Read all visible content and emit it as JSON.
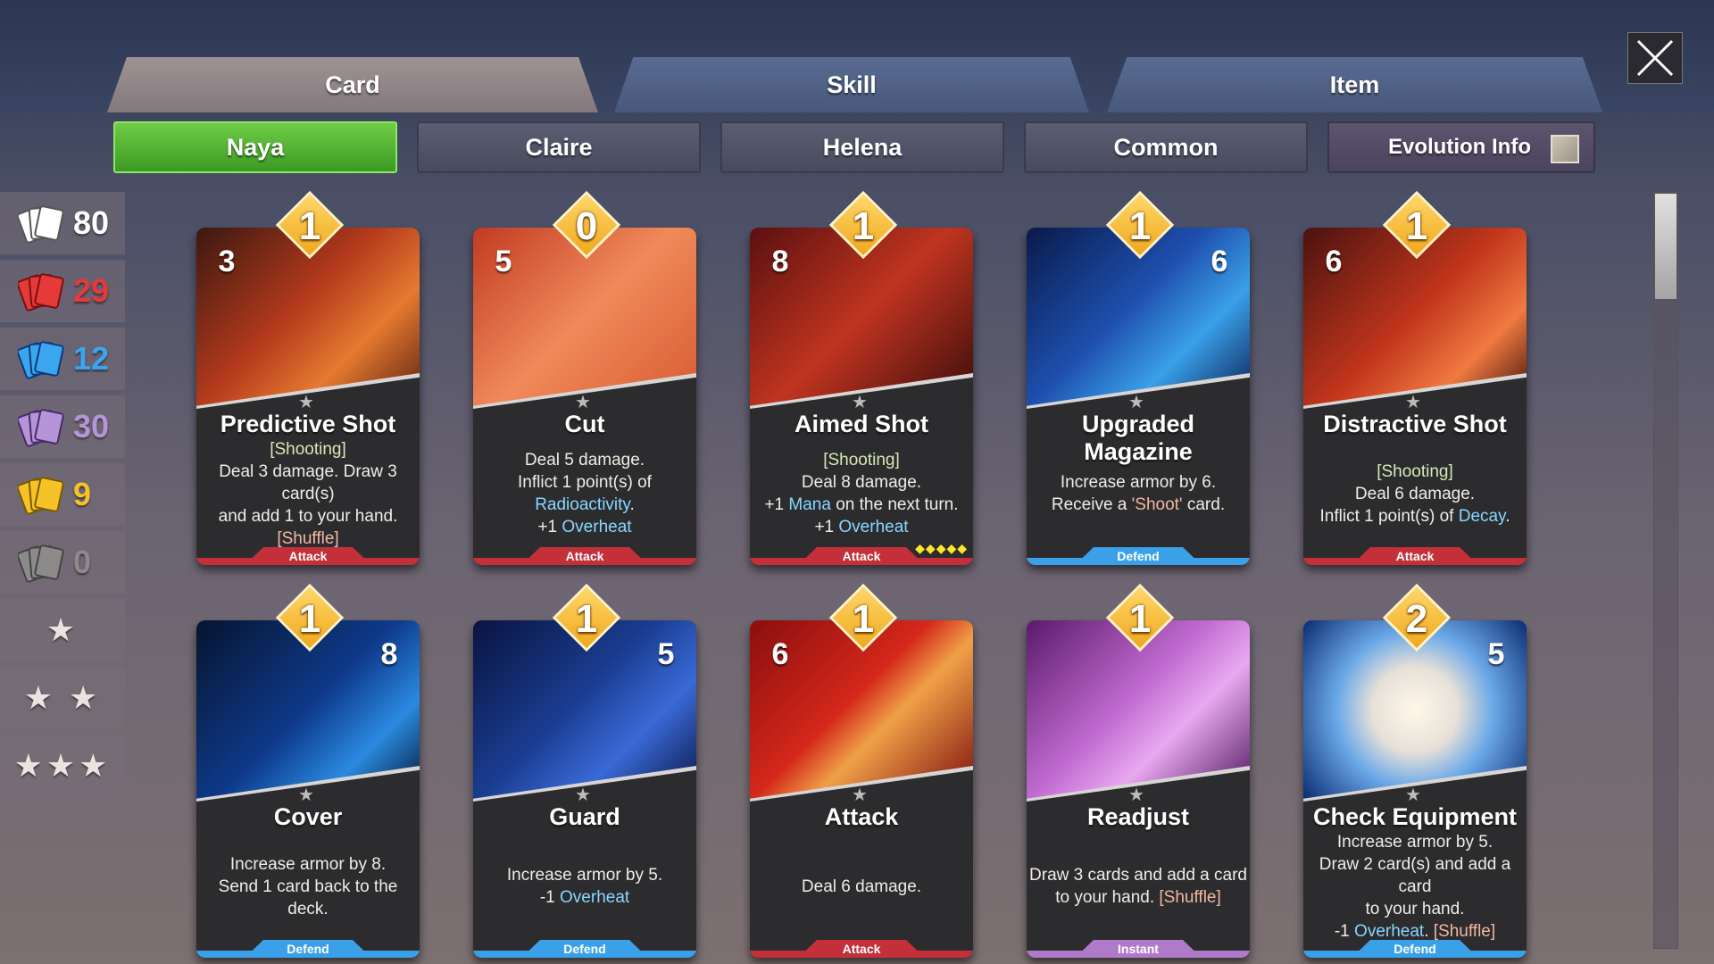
{
  "main_tabs": [
    {
      "label": "Card",
      "active": true
    },
    {
      "label": "Skill",
      "active": false
    },
    {
      "label": "Item",
      "active": false
    }
  ],
  "sub_tabs": [
    {
      "label": "Naya",
      "active": true
    },
    {
      "label": "Claire",
      "active": false
    },
    {
      "label": "Helena",
      "active": false
    },
    {
      "label": "Common",
      "active": false
    },
    {
      "label": "Evolution Info",
      "active": false
    }
  ],
  "filters": [
    {
      "icon": "cards-white-icon",
      "count": "80",
      "color": "#ffffff"
    },
    {
      "icon": "cards-red-icon",
      "count": "29",
      "color": "#e63a3a"
    },
    {
      "icon": "cards-blue-icon",
      "count": "12",
      "color": "#3aa6f0"
    },
    {
      "icon": "cards-purple-icon",
      "count": "30",
      "color": "#b595d8"
    },
    {
      "icon": "cards-yellow-icon",
      "count": "9",
      "color": "#f5c327"
    },
    {
      "icon": "cards-gray-icon",
      "count": "0",
      "color": "#8d8a8a"
    }
  ],
  "star_filters": [
    "★",
    "★ ★",
    "★★★"
  ],
  "cards": [
    {
      "name": "Predictive Shot",
      "cost": "1",
      "value": "3",
      "value_kind": "attack",
      "type": "Attack",
      "lines": [
        [
          {
            "t": "[Shooting]",
            "c": "kw"
          }
        ],
        [
          {
            "t": "Deal 3 damage. Draw 3 card(s)"
          }
        ],
        [
          {
            "t": "and add 1 to your hand."
          }
        ],
        [
          {
            "t": "[Shuffle]",
            "c": "sh"
          }
        ]
      ],
      "art": "linear-gradient(135deg,#3a1810 0%,#b53a1c 45%,#e57a30 70%,#5a2010 100%)"
    },
    {
      "name": "Cut",
      "cost": "0",
      "value": "5",
      "value_kind": "attack",
      "type": "Attack",
      "lines": [
        [
          {
            "t": "Deal 5 damage."
          }
        ],
        [
          {
            "t": "Inflict 1 point(s) of"
          }
        ],
        [
          {
            "t": "Radioactivity",
            "c": "hl"
          },
          {
            "t": "."
          }
        ],
        [
          {
            "t": "+1 "
          },
          {
            "t": "Overheat",
            "c": "hl"
          }
        ]
      ],
      "art": "linear-gradient(135deg,#c23a22 0%,#f08a5a 50%,#d85a32 100%)"
    },
    {
      "name": "Aimed Shot",
      "cost": "1",
      "value": "8",
      "value_kind": "attack",
      "type": "Attack",
      "dots": "◆◆◆◆◆",
      "lines": [
        [
          {
            "t": "[Shooting]",
            "c": "kw"
          }
        ],
        [
          {
            "t": "Deal 8 damage."
          }
        ],
        [
          {
            "t": "+1 "
          },
          {
            "t": "Mana",
            "c": "hl"
          },
          {
            "t": " on the next turn."
          }
        ],
        [
          {
            "t": "+1 "
          },
          {
            "t": "Overheat",
            "c": "hl"
          }
        ]
      ],
      "art": "linear-gradient(135deg,#5a1010 0%,#c03420 50%,#3a0c0c 100%)"
    },
    {
      "name": "Upgraded Magazine",
      "cost": "1",
      "value": "6",
      "value_kind": "defend",
      "type": "Defend",
      "lines": [
        [
          {
            "t": "Increase armor by 6."
          }
        ],
        [
          {
            "t": "Receive a "
          },
          {
            "t": "'Shoot'",
            "c": "sh"
          },
          {
            "t": " card."
          }
        ]
      ],
      "art": "linear-gradient(135deg,#0a1a4a 0%,#1e4fae 45%,#3aa0e8 70%,#0c1c50 100%)"
    },
    {
      "name": "Distractive Shot",
      "cost": "1",
      "value": "6",
      "value_kind": "attack",
      "type": "Attack",
      "lines": [
        [
          {
            "t": "[Shooting]",
            "c": "kw"
          }
        ],
        [
          {
            "t": "Deal 6 damage."
          }
        ],
        [
          {
            "t": "Inflict 1 point(s) of "
          },
          {
            "t": "Decay",
            "c": "hl"
          },
          {
            "t": "."
          }
        ]
      ],
      "art": "linear-gradient(135deg,#4a1210 0%,#c2361c 50%,#f07a40 75%,#3a0e0c 100%)"
    },
    {
      "name": "Cover",
      "cost": "1",
      "value": "8",
      "value_kind": "defend",
      "type": "Defend",
      "lines": [
        [
          {
            "t": "Increase armor by 8."
          }
        ],
        [
          {
            "t": "Send 1 card back to the deck."
          }
        ]
      ],
      "art": "linear-gradient(135deg,#061430 0%,#0e3a8a 50%,#2a8ae0 75%,#061430 100%)"
    },
    {
      "name": "Guard",
      "cost": "1",
      "value": "5",
      "value_kind": "defend",
      "type": "Defend",
      "lines": [
        [
          {
            "t": "Increase armor by 5."
          }
        ],
        [
          {
            "t": "-1 "
          },
          {
            "t": "Overheat",
            "c": "hl"
          }
        ]
      ],
      "art": "linear-gradient(135deg,#0a1440 0%,#1a3c90 45%,#3a6ad8 70%,#0a1440 100%)"
    },
    {
      "name": "Attack",
      "cost": "1",
      "value": "6",
      "value_kind": "attack",
      "type": "Attack",
      "lines": [
        [
          {
            "t": "Deal 6 damage."
          }
        ]
      ],
      "art": "linear-gradient(135deg,#8a0e0e 0%,#d4281a 45%,#f0a048 60%,#7a0c0c 100%)"
    },
    {
      "name": "Readjust",
      "cost": "1",
      "value": "",
      "value_kind": "none",
      "type": "Instant",
      "lines": [
        [
          {
            "t": "Draw 3 cards and add a card"
          }
        ],
        [
          {
            "t": "to your hand. "
          },
          {
            "t": "[Shuffle]",
            "c": "sh"
          }
        ]
      ],
      "art": "linear-gradient(135deg,#5a1a6a 0%,#c06ad0 45%,#e8a8f0 65%,#4a1458 100%)"
    },
    {
      "name": "Check Equipment",
      "cost": "2",
      "value": "5",
      "value_kind": "defend",
      "type": "Defend",
      "lines": [
        [
          {
            "t": "Increase armor by 5."
          }
        ],
        [
          {
            "t": "Draw 2 card(s) and add a card"
          }
        ],
        [
          {
            "t": "to your hand."
          }
        ],
        [
          {
            "t": "-1 "
          },
          {
            "t": "Overheat",
            "c": "hl"
          },
          {
            "t": ". "
          },
          {
            "t": "[Shuffle]",
            "c": "sh"
          }
        ]
      ],
      "art": "radial-gradient(circle at 50% 50%,#fff8e8 0%,#e6e0d8 30%,#6aa8e8 55%,#0a2a70 100%)"
    }
  ],
  "colors": {
    "attack": "#c3303a",
    "defend": "#3aa0e8",
    "instant": "#b07acb",
    "highlight": "#88d6ff",
    "active_tab": "#4fb22e"
  }
}
